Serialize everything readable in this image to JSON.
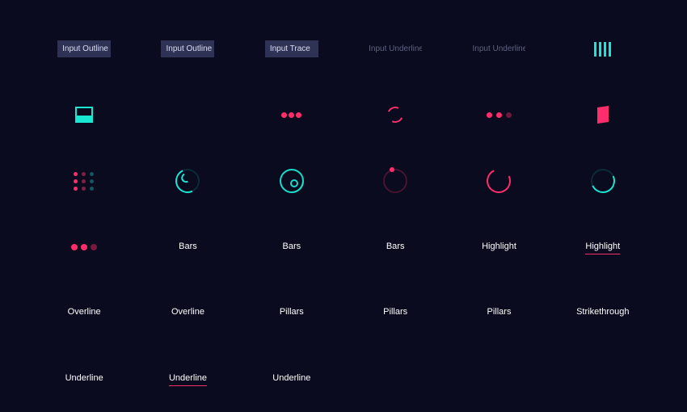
{
  "colors": {
    "bg": "#0a0b1e",
    "accent_teal": "#19e7d4",
    "accent_pink": "#ff2d6b",
    "input_bg": "#2e3356"
  },
  "row1": {
    "input_outline_1": "Input Outline",
    "input_outline_2": "Input Outline",
    "input_trace": "Input Trace",
    "input_underline_1": "Input Underline",
    "input_underline_2": "Input Underline"
  },
  "row4": {
    "bars_1": "Bars",
    "bars_2": "Bars",
    "bars_3": "Bars",
    "highlight_1": "Highlight",
    "highlight_2": "Highlight"
  },
  "row5": {
    "overline_1": "Overline",
    "overline_2": "Overline",
    "pillars_1": "Pillars",
    "pillars_2": "Pillars",
    "pillars_3": "Pillars",
    "strikethrough": "Strikethrough"
  },
  "row6": {
    "underline_1": "Underline",
    "underline_2": "Underline",
    "underline_3": "Underline"
  },
  "icons": {
    "bars": "bars-icon",
    "screen": "screen-icon",
    "dots3": "three-dots-icon",
    "spinner": "spinner-arcs-icon",
    "dots3_fade": "three-dots-fade-icon",
    "flag": "flag-icon",
    "dot_grid": "dot-grid-icon",
    "ring_progress": "ring-progress-icon",
    "ring_radar": "ring-radar-icon",
    "ring_orbit": "ring-orbit-icon",
    "ring_arc": "ring-arc-icon",
    "ring_partial": "ring-partial-icon"
  }
}
